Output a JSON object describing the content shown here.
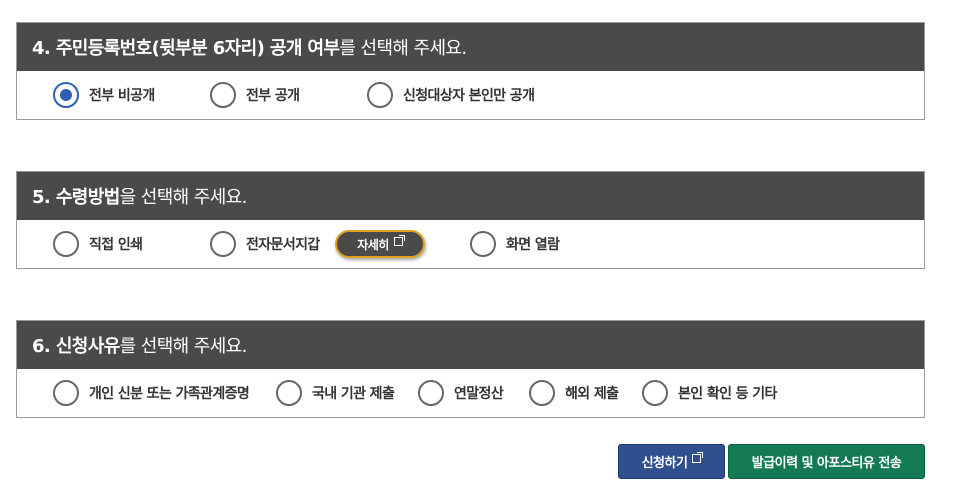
{
  "section4": {
    "title_bold": "4. 주민등록번호(뒷부분 6자리) 공개 여부",
    "title_rest": "를 선택해 주세요.",
    "options": [
      {
        "label": "전부 비공개",
        "checked": true
      },
      {
        "label": "전부 공개",
        "checked": false
      },
      {
        "label": "신청대상자 본인만 공개",
        "checked": false
      }
    ]
  },
  "section5": {
    "title_bold": "5. 수령방법",
    "title_rest": "을 선택해 주세요.",
    "options": [
      {
        "label": "직접 인쇄",
        "checked": false
      },
      {
        "label": "전자문서지갑",
        "checked": false
      },
      {
        "label": "화면 열람",
        "checked": false
      }
    ],
    "detail_button": "자세히"
  },
  "section6": {
    "title_bold": "6. 신청사유",
    "title_rest": "를 선택해 주세요.",
    "options": [
      {
        "label": "개인 신분 또는 가족관계증명",
        "checked": false
      },
      {
        "label": "국내 기관 제출",
        "checked": false
      },
      {
        "label": "연말정산",
        "checked": false
      },
      {
        "label": "해외 제출",
        "checked": false
      },
      {
        "label": "본인 확인 등 기타",
        "checked": false
      }
    ]
  },
  "actions": {
    "apply": "신청하기",
    "apostille": "발급이력 및 아포스티유 전송"
  },
  "colors": {
    "header_bg": "#4a4a4a",
    "radio_checked": "#2e5fb3",
    "apply_bg": "#2f4f8e",
    "apostille_bg": "#137a54",
    "detail_border": "#e0a21a"
  }
}
